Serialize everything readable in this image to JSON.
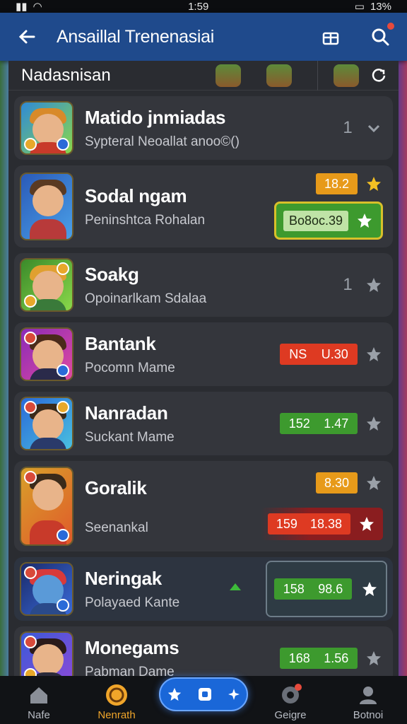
{
  "status": {
    "time": "1:59",
    "battery": "13%"
  },
  "header": {
    "title": "Ansaillal Trenenasiai"
  },
  "filter": {
    "label": "Nadasnisan"
  },
  "colors": {
    "header": "#1f4a8c",
    "accent_orange": "#e79a1a",
    "accent_red": "#de3a22",
    "accent_green": "#3d9a2e",
    "star_gold": "#f3c023"
  },
  "items": [
    {
      "name": "Matido jnmiadas",
      "sub": "Sypteral Neoallat anoo©()",
      "count": "1"
    },
    {
      "name": "Sodal ngam",
      "sub": "Peninshtca Rohalan",
      "badge": "18.2",
      "bonus": "Bo8oc.39"
    },
    {
      "name": "Soakg",
      "sub": "Opoinarlkam Sdalaa",
      "count": "1"
    },
    {
      "name": "Bantank",
      "sub": "Pocomn Mame",
      "pill_a": "NS",
      "pill_b": "U.30"
    },
    {
      "name": "Nanradan",
      "sub": "Suckant Mame",
      "pill_a": "152",
      "pill_b": "1.47"
    },
    {
      "name": "Goralik",
      "sub": "Seenankal",
      "badge": "8.30",
      "pill_a": "159",
      "pill_b": "18.38"
    },
    {
      "name": "Neringak",
      "sub": "Polayaed Kante",
      "pill_a": "158",
      "pill_b": "98.6"
    },
    {
      "name": "Monegams",
      "sub": "Pabman Dame",
      "pill_a": "168",
      "pill_b": "1.56"
    }
  ],
  "nav": [
    {
      "label": "Nafe"
    },
    {
      "label": "Nenrath"
    },
    {
      "label": "Geigre"
    },
    {
      "label": "Botnoi"
    }
  ]
}
